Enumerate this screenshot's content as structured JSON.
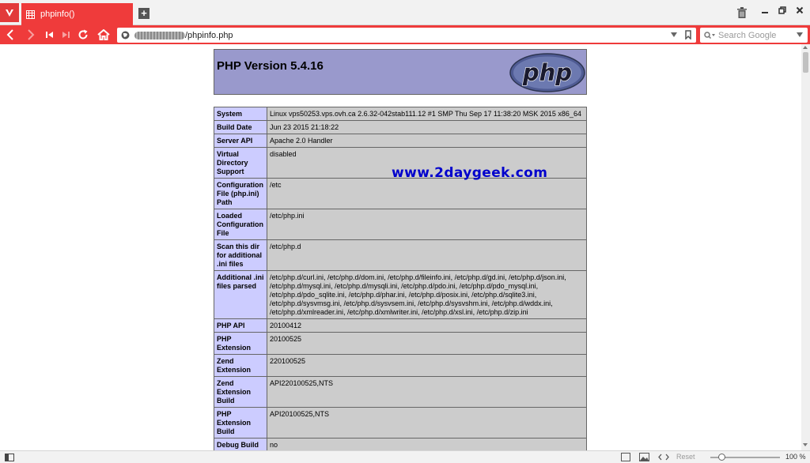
{
  "browser": {
    "tab_title": "phpinfo()",
    "url": "/phpinfo.php",
    "search_placeholder": "Search Google",
    "zoom_label": "100 %",
    "reset_label": "Reset"
  },
  "page": {
    "php_version_title": "PHP Version 5.4.16",
    "logo_text": "php",
    "watermark": "www.2daygeek.com",
    "rows": [
      {
        "label": "System",
        "value": "Linux vps50253.vps.ovh.ca 2.6.32-042stab111.12 #1 SMP Thu Sep 17 11:38:20 MSK 2015 x86_64"
      },
      {
        "label": "Build Date",
        "value": "Jun 23 2015 21:18:22"
      },
      {
        "label": "Server API",
        "value": "Apache 2.0 Handler"
      },
      {
        "label": "Virtual Directory Support",
        "value": "disabled"
      },
      {
        "label": "Configuration File (php.ini) Path",
        "value": "/etc"
      },
      {
        "label": "Loaded Configuration File",
        "value": "/etc/php.ini"
      },
      {
        "label": "Scan this dir for additional .ini files",
        "value": "/etc/php.d"
      },
      {
        "label": "Additional .ini files parsed",
        "value": "/etc/php.d/curl.ini, /etc/php.d/dom.ini, /etc/php.d/fileinfo.ini, /etc/php.d/gd.ini, /etc/php.d/json.ini, /etc/php.d/mysql.ini, /etc/php.d/mysqli.ini, /etc/php.d/pdo.ini, /etc/php.d/pdo_mysql.ini, /etc/php.d/pdo_sqlite.ini, /etc/php.d/phar.ini, /etc/php.d/posix.ini, /etc/php.d/sqlite3.ini, /etc/php.d/sysvmsg.ini, /etc/php.d/sysvsem.ini, /etc/php.d/sysvshm.ini, /etc/php.d/wddx.ini, /etc/php.d/xmlreader.ini, /etc/php.d/xmlwriter.ini, /etc/php.d/xsl.ini, /etc/php.d/zip.ini"
      },
      {
        "label": "PHP API",
        "value": "20100412"
      },
      {
        "label": "PHP Extension",
        "value": "20100525"
      },
      {
        "label": "Zend Extension",
        "value": "220100525"
      },
      {
        "label": "Zend Extension Build",
        "value": "API220100525,NTS"
      },
      {
        "label": "PHP Extension Build",
        "value": "API20100525,NTS"
      },
      {
        "label": "Debug Build",
        "value": "no"
      }
    ]
  },
  "colors": {
    "accent": "#ef3b3b",
    "php_header": "#9999cc",
    "label_cell": "#ccccff",
    "value_cell": "#cccccc",
    "watermark": "#0000cc"
  },
  "icons": {
    "vivaldi_menu": "vivaldi-logo-icon",
    "tab_favicon": "grid-favicon-icon",
    "new_tab": "plus-icon",
    "trash": "trash-icon",
    "minimize": "minimize-icon",
    "restore": "restore-icon",
    "close": "close-icon",
    "back": "back-arrow-icon",
    "forward": "forward-arrow-icon",
    "rewind": "rewind-icon",
    "fast_forward": "fast-forward-icon",
    "reload": "reload-icon",
    "home": "home-icon",
    "site_info": "globe-icon",
    "bookmark": "bookmark-icon",
    "search": "search-icon"
  }
}
